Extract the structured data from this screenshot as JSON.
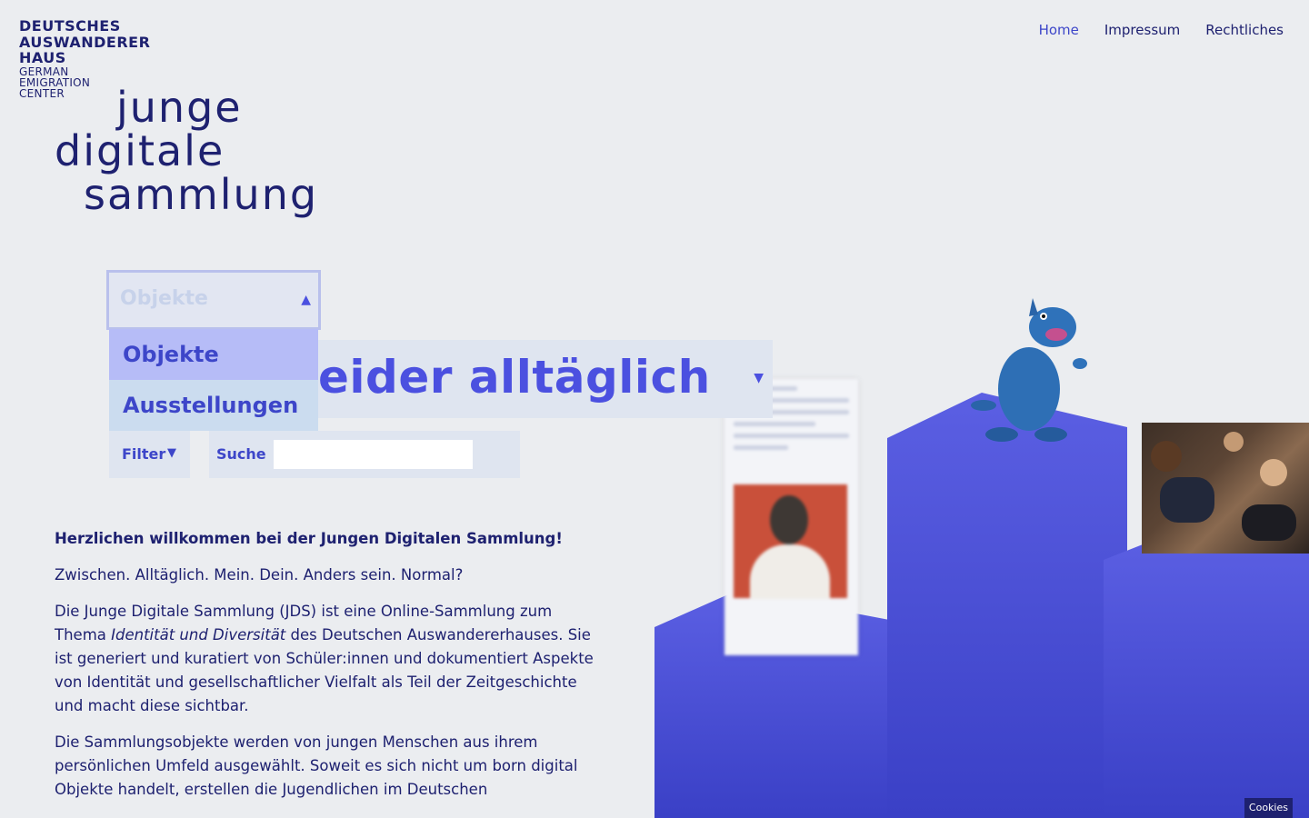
{
  "logo": {
    "line1": "DEUTSCHES",
    "line2": "AUSWANDERER",
    "line3": "HAUS",
    "sub1": "GERMAN",
    "sub2": "EMIGRATION",
    "sub3": "CENTER"
  },
  "nav": {
    "items": [
      {
        "label": "Home"
      },
      {
        "label": "Impressum"
      },
      {
        "label": "Rechtliches"
      }
    ]
  },
  "brand": {
    "line1": "junge",
    "line2": "digitale",
    "line3": "sammlung"
  },
  "phrase": {
    "text": "eider alltäglich",
    "arrow": "▼"
  },
  "dropdown": {
    "selected": "Objekte",
    "arrow": "▲",
    "options": [
      {
        "label": "Objekte"
      },
      {
        "label": "Ausstellungen"
      }
    ]
  },
  "filter": {
    "label": "Filter",
    "arrow": "▼"
  },
  "search": {
    "label": "Suche",
    "value": ""
  },
  "content": {
    "intro": "Herzlichen willkommen bei der Jungen Digitalen Sammlung!",
    "p1": "Zwischen. Alltäglich. Mein. Dein. Anders sein. Normal?",
    "p2_a": "Die Junge Digitale Sammlung (JDS) ist eine Online-Sammlung zum Thema ",
    "p2_em": "Identität und Diversität",
    "p2_b": " des Deutschen Auswandererhauses. Sie ist generiert und kuratiert von Schüler:innen und dokumentiert Aspekte von Identität und gesellschaftlicher Vielfalt als Teil der Zeitgeschichte und macht diese sichtbar.",
    "p3": "Die Sammlungsobjekte werden von jungen Menschen aus ihrem persönlichen Umfeld ausgewählt. Soweit es sich nicht um born digital Objekte handelt, erstellen die Jugendlichen im Deutschen"
  },
  "cookies": {
    "label": "Cookies"
  },
  "colors": {
    "background": "#ebedf0",
    "text": "#1e2170",
    "accent": "#4b50e0",
    "stage_top": "#5b5fe3",
    "stage_bottom": "#3a40c6"
  }
}
